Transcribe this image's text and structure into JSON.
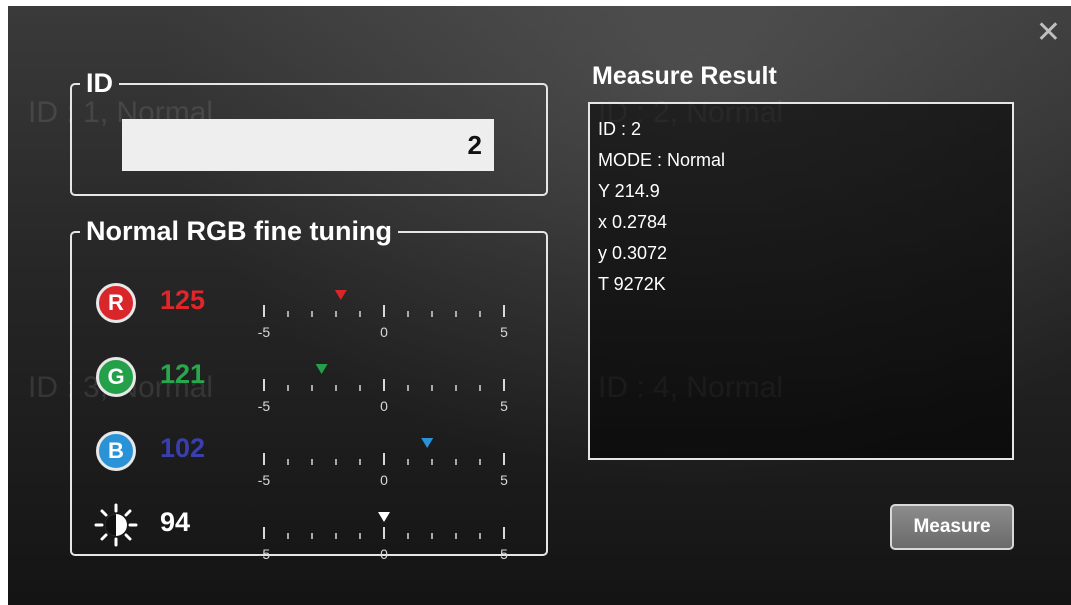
{
  "dialog": {
    "close_glyph": "✕"
  },
  "id_section": {
    "legend": "ID",
    "value": "2"
  },
  "rgb_section": {
    "legend": "Normal RGB fine tuning",
    "scale_labels": [
      "-5",
      "0",
      "5"
    ],
    "rows": [
      {
        "key": "R",
        "badge": "R",
        "badge_color": "#d8262b",
        "value": "125",
        "value_color": "#e0262b",
        "marker_color": "#d8262b",
        "offset": -1.8
      },
      {
        "key": "G",
        "badge": "G",
        "badge_color": "#24a04a",
        "value": "121",
        "value_color": "#28a84c",
        "marker_color": "#24a04a",
        "offset": -2.6
      },
      {
        "key": "B",
        "badge": "B",
        "badge_color": "#2a93d8",
        "value": "102",
        "value_color": "#3a3fb0",
        "marker_color": "#2a93d8",
        "offset": 1.8
      },
      {
        "key": "brightness",
        "icon": "brightness-icon",
        "value": "94",
        "value_color": "#ffffff",
        "marker_color": "#ffffff",
        "offset": 0
      }
    ]
  },
  "measure_result": {
    "title": "Measure Result",
    "lines": [
      "ID : 2",
      "MODE : Normal",
      "Y 214.9",
      "x 0.2784",
      "y 0.3072",
      "T 9272K"
    ]
  },
  "measure_button": {
    "label": "Measure"
  }
}
